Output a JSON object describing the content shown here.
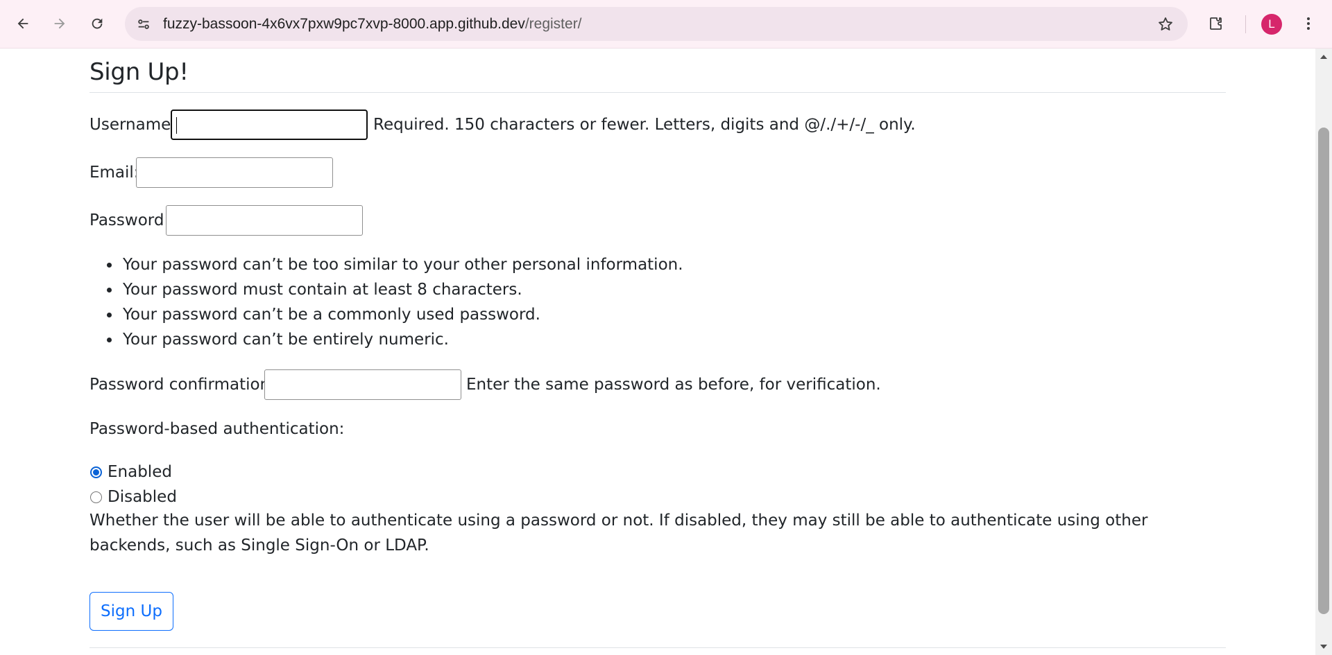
{
  "browser": {
    "url_host": "fuzzy-bassoon-4x6vx7pxw9pc7xvp-8000.app.github.dev",
    "url_path": "/register/",
    "profile_initial": "L",
    "colors": {
      "chrome_bg": "#fdf0f6",
      "omnibox_bg": "#f1e3ec",
      "avatar": "#d6266b"
    },
    "icons": [
      "back-arrow-icon",
      "forward-arrow-icon",
      "reload-icon",
      "site-info-icon",
      "bookmark-star-icon",
      "extensions-icon",
      "kebab-menu-icon"
    ]
  },
  "form": {
    "title": "Sign Up!",
    "username": {
      "label": "Username:",
      "value": "",
      "help": "Required. 150 characters or fewer. Letters, digits and @/./+/-/_ only."
    },
    "email": {
      "label": "Email:",
      "value": ""
    },
    "password": {
      "label": "Password:",
      "value": "",
      "rules": [
        "Your password can’t be too similar to your other personal information.",
        "Your password must contain at least 8 characters.",
        "Your password can’t be a commonly used password.",
        "Your password can’t be entirely numeric."
      ]
    },
    "password_confirmation": {
      "label": "Password confirmation:",
      "value": "",
      "help": "Enter the same password as before, for verification."
    },
    "auth": {
      "label": "Password-based authentication:",
      "options": [
        "Enabled",
        "Disabled"
      ],
      "selected": "Enabled",
      "help": "Whether the user will be able to authenticate using a password or not. If disabled, they may still be able to authenticate using other backends, such as Single Sign-On or LDAP."
    },
    "submit_label": "Sign Up",
    "colors": {
      "primary": "#0d6efd",
      "radio_checked": "#0b63d6",
      "text": "#212529",
      "rule": "#dee2e6"
    }
  }
}
